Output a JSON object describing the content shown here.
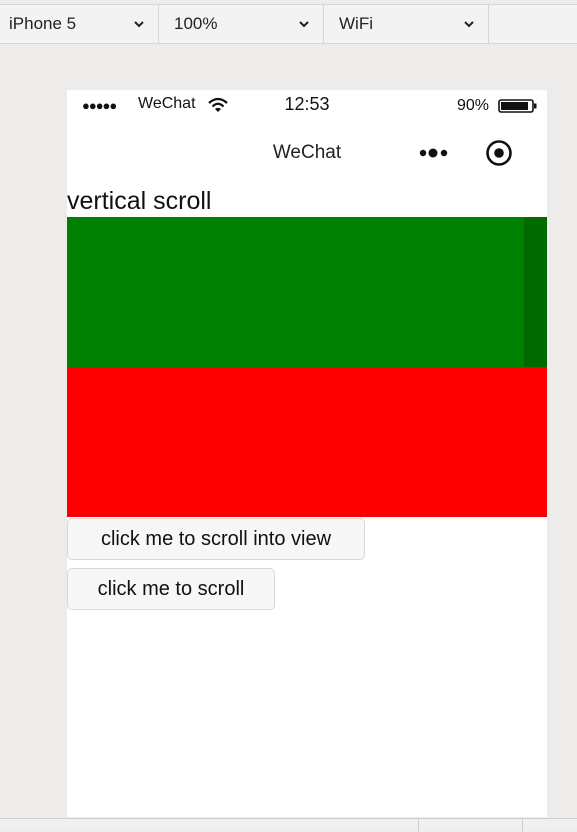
{
  "toolbar": {
    "device": "iPhone 5",
    "zoom": "100%",
    "network": "WiFi"
  },
  "status_bar": {
    "signal": "●●●●●",
    "carrier": "WeChat",
    "time": "12:53",
    "battery": "90%",
    "battery_level": 0.9
  },
  "nav": {
    "title": "WeChat"
  },
  "page": {
    "section_title": "vertical scroll",
    "scroll_blocks": [
      {
        "color": "#008000"
      },
      {
        "color": "#ff0000"
      }
    ],
    "buttons": {
      "scroll_into_view": "click me to scroll into view",
      "scroll": "click me to scroll"
    }
  },
  "colors": {
    "background": "#edecea",
    "phone_bg": "#ffffff",
    "green": "#008000",
    "red": "#ff0000"
  },
  "icons": [
    "chevron-down-icon",
    "wifi-icon",
    "battery-icon",
    "more-icon",
    "record-icon"
  ]
}
